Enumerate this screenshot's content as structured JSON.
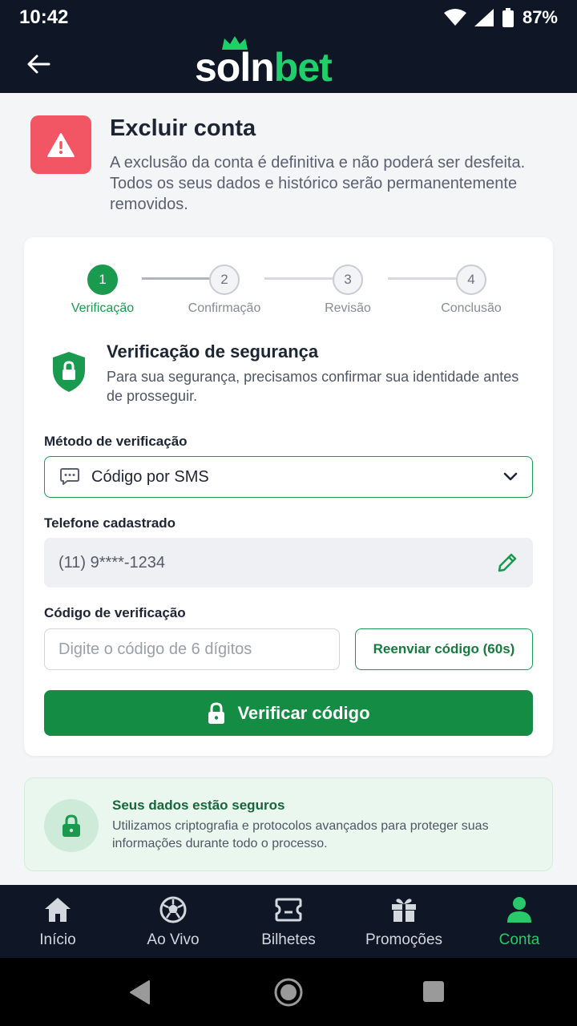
{
  "status_bar": {
    "time": "10:42",
    "battery": "87%"
  },
  "header": {
    "logo_part1": "soln",
    "logo_part2": "bet"
  },
  "warning": {
    "title": "Excluir conta",
    "description": "A exclusão da conta é definitiva e não poderá ser desfeita. Todos os seus dados e histórico serão permanentemente removidos."
  },
  "stepper": {
    "steps": [
      {
        "number": "1",
        "label": "Verificação"
      },
      {
        "number": "2",
        "label": "Confirmação"
      },
      {
        "number": "3",
        "label": "Revisão"
      },
      {
        "number": "4",
        "label": "Conclusão"
      }
    ],
    "active_step": 1
  },
  "security": {
    "title": "Verificação de segurança",
    "description": "Para sua segurança, precisamos confirmar sua identidade antes de prosseguir."
  },
  "form": {
    "method_label": "Método de verificação",
    "method_value": "Código por SMS",
    "phone_label": "Telefone cadastrado",
    "phone_value": "(11) 9****-1234",
    "code_label": "Código de verificação",
    "code_placeholder": "Digite o código de 6 dígitos",
    "code_value": "",
    "resend_label": "Reenviar código (60s)",
    "verify_label": "Verificar código"
  },
  "safe_notice": {
    "title": "Seus dados estão seguros",
    "description": "Utilizamos criptografia e protocolos avançados para proteger suas informações durante todo o processo."
  },
  "bottom_nav": {
    "items": [
      {
        "label": "Início",
        "icon": "home-icon"
      },
      {
        "label": "Ao Vivo",
        "icon": "soccer-ball-icon"
      },
      {
        "label": "Bilhetes",
        "icon": "ticket-icon"
      },
      {
        "label": "Promoções",
        "icon": "gift-icon"
      },
      {
        "label": "Conta",
        "icon": "user-icon"
      }
    ],
    "active": "Conta"
  },
  "colors": {
    "brand_green": "#1a9a4e",
    "logo_green": "#1fcf6a",
    "header_dark": "#0f1726",
    "danger": "#f25563"
  }
}
